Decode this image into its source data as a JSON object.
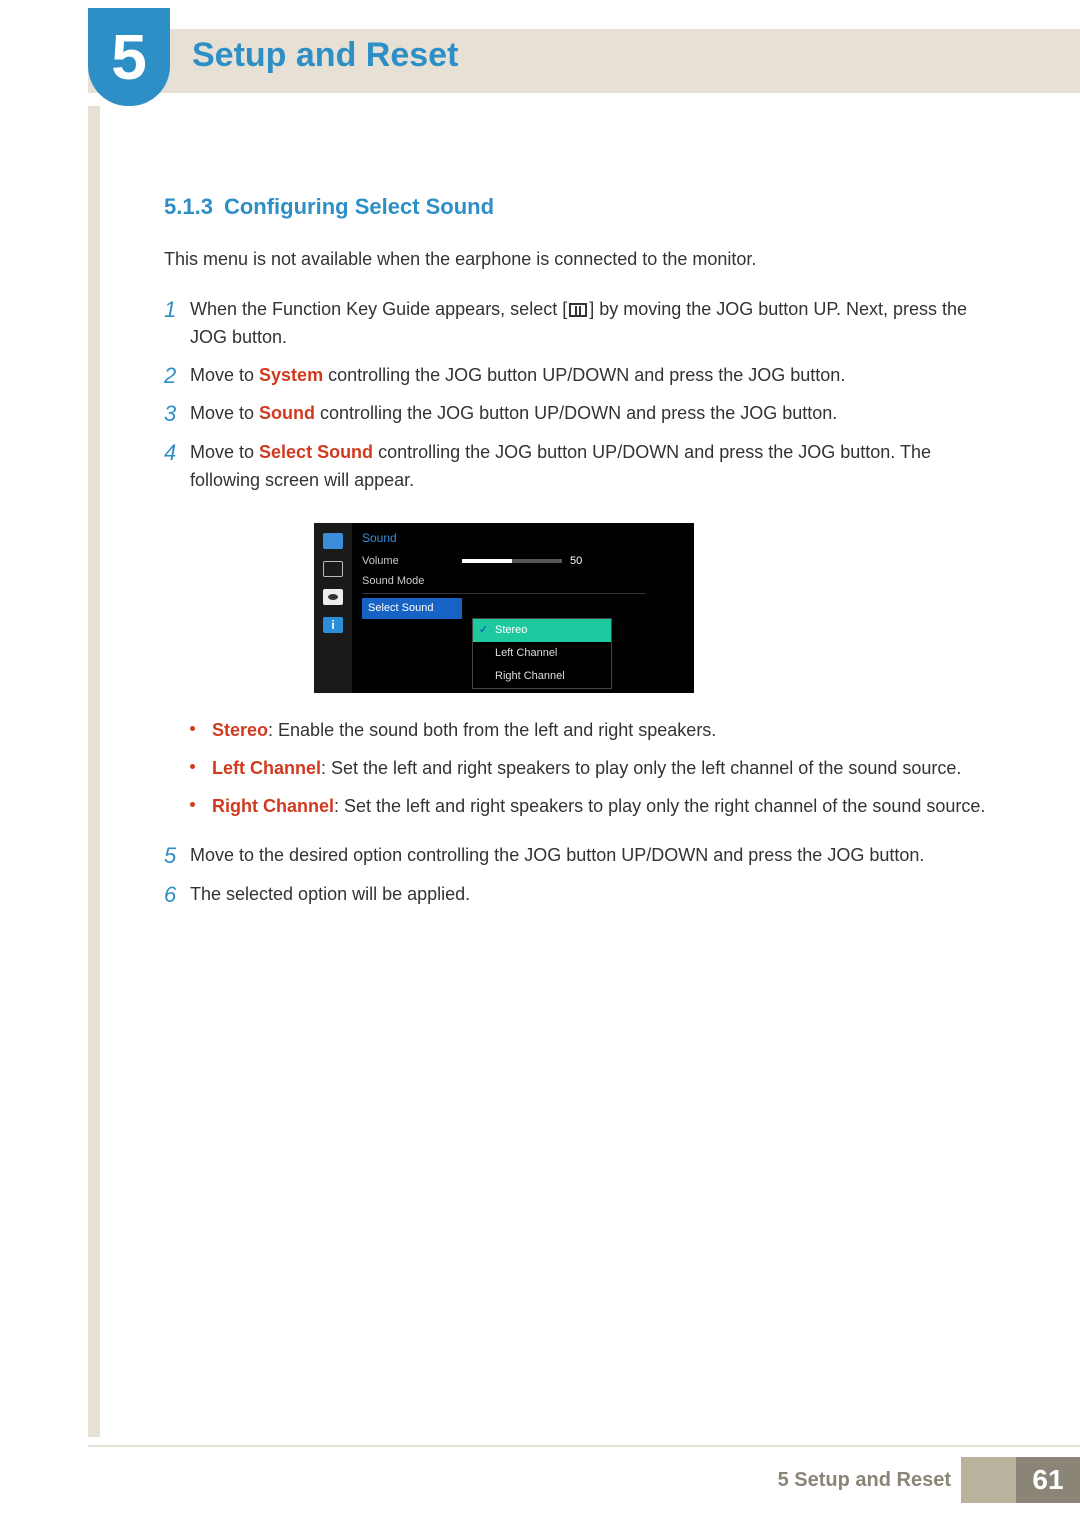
{
  "chapter": {
    "number": "5",
    "title": "Setup and Reset"
  },
  "section": {
    "number": "5.1.3",
    "title": "Configuring Select Sound"
  },
  "intro": "This menu is not available when the earphone is connected to the monitor.",
  "steps": {
    "s1": {
      "pre": "When the Function Key Guide appears, select [",
      "post": "] by moving the JOG button UP. Next, press the JOG button."
    },
    "s2": {
      "a": "Move to ",
      "hl": "System",
      "b": " controlling the JOG button UP/DOWN and press the JOG button."
    },
    "s3": {
      "a": "Move to ",
      "hl": "Sound",
      "b": " controlling the JOG button UP/DOWN and press the JOG button."
    },
    "s4": {
      "a": "Move to ",
      "hl": "Select Sound",
      "b": " controlling the JOG button UP/DOWN and press the JOG button. The following screen will appear."
    },
    "s5": "Move to the desired option controlling the JOG button UP/DOWN and press the JOG button.",
    "s6": "The selected option will be applied."
  },
  "nums": {
    "n1": "1",
    "n2": "2",
    "n3": "3",
    "n4": "4",
    "n5": "5",
    "n6": "6"
  },
  "osd": {
    "header": "Sound",
    "volume_label": "Volume",
    "volume_value": "50",
    "sound_mode_label": "Sound Mode",
    "select_sound_label": "Select Sound",
    "options": {
      "stereo": "Stereo",
      "left": "Left Channel",
      "right": "Right Channel"
    }
  },
  "bullets": {
    "b1": {
      "hl": "Stereo",
      "t": ": Enable the sound both from the left and right speakers."
    },
    "b2": {
      "hl": "Left Channel",
      "t": ": Set the left and right speakers to play only the left channel of the sound source."
    },
    "b3": {
      "hl": "Right Channel",
      "t": ": Set the left and right speakers to play only the right channel of the sound source."
    }
  },
  "footer": {
    "text": "5 Setup and Reset",
    "page": "61"
  }
}
